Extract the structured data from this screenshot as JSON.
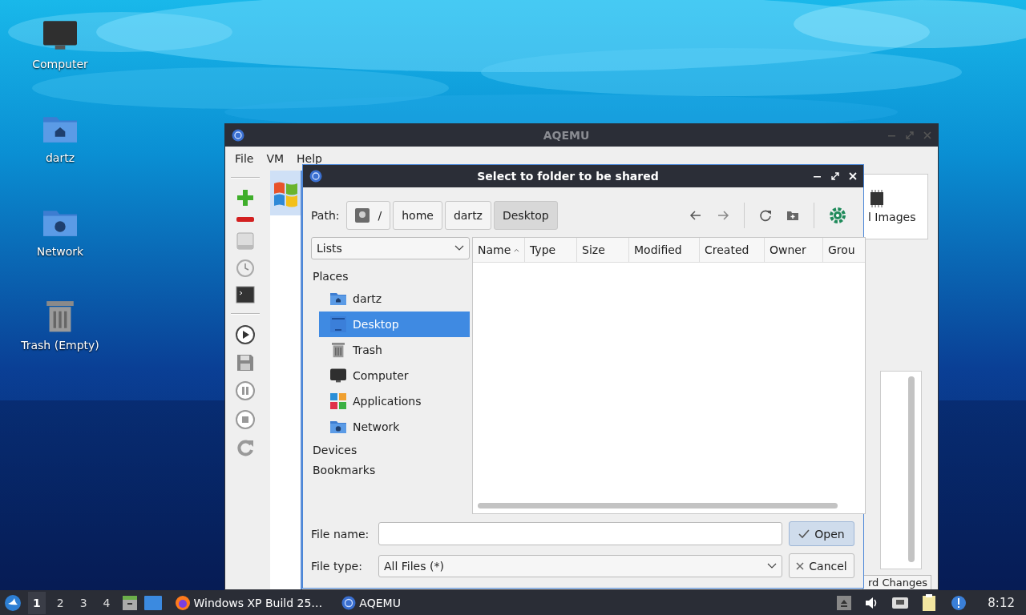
{
  "desktop": {
    "icons": [
      {
        "label": "Computer",
        "kind": "computer"
      },
      {
        "label": "dartz",
        "kind": "home"
      },
      {
        "label": "Network",
        "kind": "network"
      },
      {
        "label": "Trash (Empty)",
        "kind": "trash"
      }
    ]
  },
  "main_window": {
    "title": "AQEMU",
    "menu": [
      "File",
      "VM",
      "Help"
    ],
    "tab_partial": "l Images",
    "button_partial": "rd Changes"
  },
  "dialog": {
    "title": "Select to folder to be shared",
    "path_label": "Path:",
    "breadcrumbs": [
      {
        "label": "/",
        "kind": "root",
        "selected": false
      },
      {
        "label": "home",
        "kind": "dir",
        "selected": false
      },
      {
        "label": "dartz",
        "kind": "dir",
        "selected": false
      },
      {
        "label": "Desktop",
        "kind": "dir",
        "selected": true
      }
    ],
    "view_mode": "Lists",
    "sections": [
      {
        "label": "Places",
        "items": [
          {
            "label": "dartz",
            "kind": "home",
            "selected": false
          },
          {
            "label": "Desktop",
            "kind": "desktop",
            "selected": true
          },
          {
            "label": "Trash",
            "kind": "trash",
            "selected": false
          },
          {
            "label": "Computer",
            "kind": "computer",
            "selected": false
          },
          {
            "label": "Applications",
            "kind": "apps",
            "selected": false
          },
          {
            "label": "Network",
            "kind": "network",
            "selected": false
          }
        ]
      },
      {
        "label": "Devices"
      },
      {
        "label": "Bookmarks"
      }
    ],
    "columns": [
      {
        "label": "Name",
        "sorted": true
      },
      {
        "label": "Type",
        "sorted": false
      },
      {
        "label": "Size",
        "sorted": false
      },
      {
        "label": "Modified",
        "sorted": false
      },
      {
        "label": "Created",
        "sorted": false
      },
      {
        "label": "Owner",
        "sorted": false
      },
      {
        "label": "Grou",
        "sorted": false
      }
    ],
    "file_name_label": "File name:",
    "file_type_label": "File type:",
    "file_type": "All Files (*)",
    "buttons": [
      {
        "label": "Open",
        "kind": "default"
      },
      {
        "label": "Cancel",
        "kind": "cancel"
      }
    ]
  },
  "taskbar": {
    "workspaces": [
      {
        "label": "1",
        "selected": true
      },
      {
        "label": "2",
        "selected": false
      },
      {
        "label": "3",
        "selected": false
      },
      {
        "label": "4",
        "selected": false
      }
    ],
    "tasks": [
      {
        "label": "Windows XP Build 25…",
        "kind": "browser"
      },
      {
        "label": "AQEMU",
        "kind": "aqemu"
      }
    ],
    "clock": "8:12"
  }
}
